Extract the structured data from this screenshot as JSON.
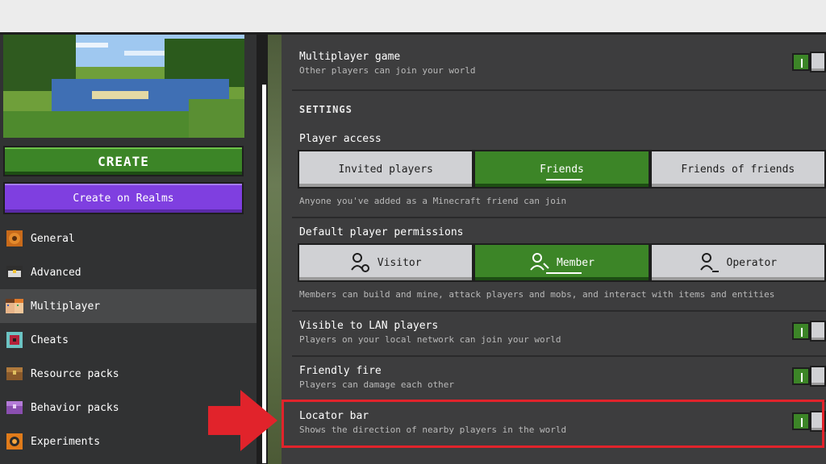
{
  "left": {
    "create_label": "CREATE",
    "realms_label": "Create on Realms",
    "nav": [
      {
        "label": "General",
        "icon": "gear-icon"
      },
      {
        "label": "Advanced",
        "icon": "chest-icon"
      },
      {
        "label": "Multiplayer",
        "icon": "players-icon",
        "active": true
      },
      {
        "label": "Cheats",
        "icon": "cheats-icon"
      },
      {
        "label": "Resource packs",
        "icon": "resource-packs-icon"
      },
      {
        "label": "Behavior packs",
        "icon": "behavior-packs-icon"
      },
      {
        "label": "Experiments",
        "icon": "experiments-icon"
      }
    ]
  },
  "multiplayer_game": {
    "title": "Multiplayer game",
    "desc": "Other players can join your world",
    "on": true
  },
  "settings_header": "SETTINGS",
  "player_access": {
    "title": "Player access",
    "options": [
      "Invited players",
      "Friends",
      "Friends of friends"
    ],
    "selected": "Friends",
    "desc": "Anyone you've added as a Minecraft friend can join"
  },
  "default_permissions": {
    "title": "Default player permissions",
    "options": [
      "Visitor",
      "Member",
      "Operator"
    ],
    "selected": "Member",
    "desc": "Members can build and mine, attack players and mobs, and interact with items and entities"
  },
  "visible_lan": {
    "title": "Visible to LAN players",
    "desc": "Players on your local network can join your world",
    "on": true
  },
  "friendly_fire": {
    "title": "Friendly fire",
    "desc": "Players can damage each other",
    "on": true
  },
  "locator_bar": {
    "title": "Locator bar",
    "desc": "Shows the direction of nearby players in the world",
    "on": true
  },
  "colors": {
    "accent_green": "#3c8527",
    "realms_purple": "#7f3fe0",
    "highlight_red": "#e1232b"
  }
}
